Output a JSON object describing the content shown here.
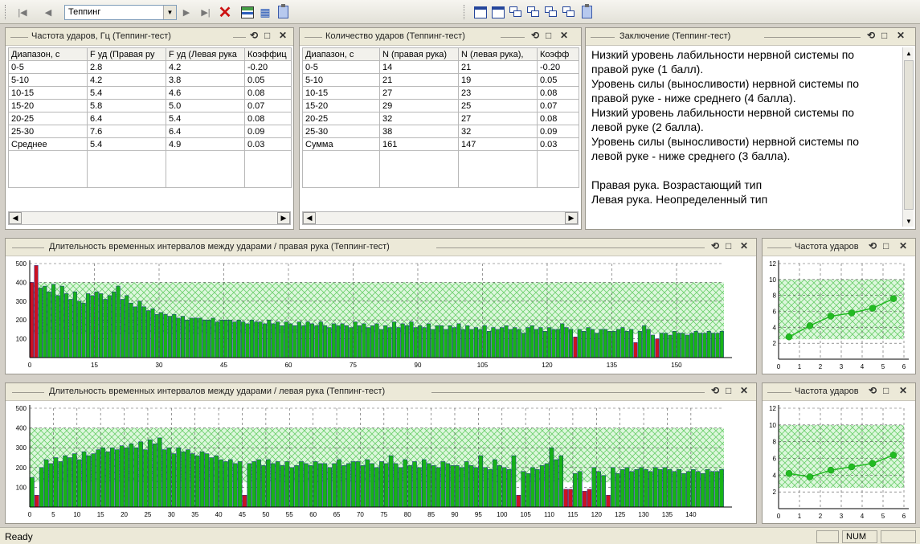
{
  "toolbar": {
    "combo_value": "Теппинг",
    "icons": [
      "first-icon",
      "prev-icon",
      "next-icon",
      "last-icon",
      "delete-icon",
      "chart-icon",
      "multichart-icon",
      "clipboard-icon",
      "window-icon",
      "window-icon",
      "tile-icon",
      "tile-icon",
      "tile-icon",
      "tile-icon",
      "clipboard-icon"
    ],
    "colors": {
      "delete": "#cc1111",
      "accent": "#24459b"
    }
  },
  "freq_table": {
    "title": "Частота ударов, Гц (Теппинг-тест)",
    "headers": [
      "Диапазон, с",
      "F уд (Правая ру",
      "F уд (Левая рука",
      "Коэффиц"
    ],
    "rows": [
      [
        "0-5",
        "2.8",
        "4.2",
        "-0.20"
      ],
      [
        "5-10",
        "4.2",
        "3.8",
        "0.05"
      ],
      [
        "10-15",
        "5.4",
        "4.6",
        "0.08"
      ],
      [
        "15-20",
        "5.8",
        "5.0",
        "0.07"
      ],
      [
        "20-25",
        "6.4",
        "5.4",
        "0.08"
      ],
      [
        "25-30",
        "7.6",
        "6.4",
        "0.09"
      ],
      [
        "Среднее",
        "5.4",
        "4.9",
        "0.03"
      ]
    ]
  },
  "count_table": {
    "title": "Количество ударов (Теппинг-тест)",
    "headers": [
      "Диапазон, с",
      "N (правая рука)",
      "N (левая рука),",
      "Коэфф"
    ],
    "rows": [
      [
        "0-5",
        "14",
        "21",
        "-0.20"
      ],
      [
        "5-10",
        "21",
        "19",
        "0.05"
      ],
      [
        "10-15",
        "27",
        "23",
        "0.08"
      ],
      [
        "15-20",
        "29",
        "25",
        "0.07"
      ],
      [
        "20-25",
        "32",
        "27",
        "0.08"
      ],
      [
        "25-30",
        "38",
        "32",
        "0.09"
      ],
      [
        "Сумма",
        "161",
        "147",
        "0.03"
      ]
    ]
  },
  "conclusion": {
    "title": "Заключение (Теппинг-тест)",
    "lines": [
      "Низкий уровень лабильности нервной системы по",
      "правой руке (1 балл).",
      "Уровень силы (выносливости) нервной системы по",
      "правой руке - ниже среднего (4 балла).",
      "Низкий уровень лабильности нервной системы по",
      "левой руке (2 балла).",
      "Уровень силы (выносливости) нервной системы по",
      "левой руке - ниже среднего (3 балла).",
      "",
      "Правая рука. Возрастающий тип",
      "Левая рука. Неопределенный тип"
    ]
  },
  "status": {
    "text": "Ready",
    "num": "NUM"
  },
  "chart_data": [
    {
      "type": "bar",
      "title": "Длительность временных интервалов между ударами / правая рука (Теппинг-тест)",
      "xlim": [
        0,
        161
      ],
      "ylim": [
        0,
        500
      ],
      "x_ticks": [
        "0",
        "15",
        "30",
        "45",
        "60",
        "75",
        "90",
        "105",
        "120",
        "135",
        "150"
      ],
      "y_ticks": [
        "100",
        "200",
        "300",
        "400",
        "500"
      ],
      "norm_band": [
        125,
        400
      ],
      "colors": {
        "bar": "#17b317",
        "bar_edge": "#1a2f8c",
        "highlight": "#cc1122",
        "band": "#99e699"
      },
      "highlight_index": [
        0,
        1,
        126,
        140,
        145
      ],
      "values": [
        400,
        490,
        370,
        380,
        350,
        390,
        330,
        380,
        340,
        310,
        350,
        300,
        290,
        340,
        330,
        350,
        340,
        310,
        330,
        350,
        380,
        310,
        330,
        290,
        270,
        300,
        270,
        250,
        260,
        230,
        240,
        230,
        220,
        230,
        210,
        220,
        200,
        210,
        210,
        210,
        200,
        200,
        210,
        190,
        200,
        200,
        200,
        190,
        200,
        190,
        180,
        200,
        190,
        190,
        180,
        200,
        180,
        190,
        170,
        190,
        180,
        170,
        190,
        170,
        190,
        180,
        170,
        190,
        170,
        160,
        180,
        170,
        180,
        170,
        160,
        190,
        170,
        180,
        160,
        170,
        180,
        150,
        170,
        160,
        190,
        160,
        180,
        170,
        190,
        160,
        170,
        160,
        180,
        150,
        170,
        170,
        150,
        170,
        160,
        180,
        150,
        170,
        150,
        160,
        150,
        170,
        140,
        160,
        150,
        160,
        170,
        150,
        160,
        150,
        130,
        160,
        170,
        150,
        160,
        140,
        160,
        150,
        150,
        180,
        160,
        150,
        110,
        150,
        140,
        160,
        150,
        130,
        150,
        150,
        140,
        140,
        150,
        160,
        140,
        150,
        80,
        140,
        170,
        150,
        120,
        100,
        130,
        130,
        120,
        140,
        130,
        130,
        120,
        130,
        140,
        130,
        130,
        140,
        130,
        130,
        140
      ]
    },
    {
      "type": "line",
      "title": "Частота ударов",
      "xlim": [
        0,
        6
      ],
      "ylim": [
        0,
        12
      ],
      "x_ticks": [
        "0",
        "1",
        "2",
        "3",
        "4",
        "5",
        "6"
      ],
      "y_ticks": [
        "2",
        "4",
        "6",
        "8",
        "10",
        "12"
      ],
      "norm_band": [
        2.5,
        10
      ],
      "colors": {
        "line": "#22bb22",
        "band": "#99e699"
      },
      "x": [
        0.5,
        1.5,
        2.5,
        3.5,
        4.5,
        5.5
      ],
      "values": [
        2.8,
        4.2,
        5.4,
        5.8,
        6.4,
        7.6
      ]
    },
    {
      "type": "bar",
      "title": "Длительность временных интервалов между ударами / левая рука (Теппинг-тест)",
      "xlim": [
        0,
        147
      ],
      "ylim": [
        0,
        500
      ],
      "x_ticks": [
        "0",
        "5",
        "10",
        "15",
        "20",
        "25",
        "30",
        "35",
        "40",
        "45",
        "50",
        "55",
        "60",
        "65",
        "70",
        "75",
        "80",
        "85",
        "90",
        "95",
        "100",
        "105",
        "110",
        "115",
        "120",
        "125",
        "130",
        "135",
        "140"
      ],
      "y_ticks": [
        "100",
        "200",
        "300",
        "400",
        "500"
      ],
      "norm_band": [
        125,
        400
      ],
      "colors": {
        "bar": "#17b317",
        "bar_edge": "#1a2f8c",
        "highlight": "#cc1122",
        "band": "#99e699"
      },
      "highlight_index": [
        1,
        45,
        103,
        113,
        114,
        117,
        118,
        122
      ],
      "values": [
        150,
        60,
        200,
        240,
        220,
        250,
        230,
        260,
        250,
        270,
        240,
        280,
        260,
        270,
        290,
        300,
        280,
        300,
        290,
        310,
        300,
        320,
        300,
        330,
        290,
        340,
        320,
        350,
        290,
        300,
        270,
        300,
        280,
        290,
        270,
        260,
        280,
        270,
        250,
        260,
        240,
        230,
        240,
        220,
        230,
        60,
        220,
        230,
        240,
        210,
        240,
        220,
        230,
        210,
        230,
        200,
        210,
        230,
        220,
        210,
        230,
        220,
        220,
        200,
        220,
        240,
        210,
        220,
        230,
        230,
        210,
        240,
        220,
        200,
        230,
        220,
        260,
        220,
        200,
        240,
        210,
        230,
        200,
        240,
        220,
        210,
        200,
        230,
        220,
        210,
        210,
        200,
        230,
        210,
        200,
        260,
        200,
        190,
        240,
        210,
        200,
        190,
        260,
        60,
        180,
        170,
        200,
        190,
        210,
        220,
        300,
        240,
        260,
        90,
        90,
        170,
        180,
        80,
        90,
        200,
        180,
        160,
        60,
        200,
        170,
        190,
        200,
        180,
        190,
        200,
        190,
        180,
        200,
        190,
        200,
        190,
        180,
        190,
        170,
        180,
        190,
        180,
        170,
        190,
        180,
        180,
        190
      ]
    },
    {
      "type": "line",
      "title": "Частота ударов",
      "xlim": [
        0,
        6
      ],
      "ylim": [
        0,
        12
      ],
      "x_ticks": [
        "0",
        "1",
        "2",
        "3",
        "4",
        "5",
        "6"
      ],
      "y_ticks": [
        "2",
        "4",
        "6",
        "8",
        "10",
        "12"
      ],
      "norm_band": [
        2.5,
        10
      ],
      "colors": {
        "line": "#22bb22",
        "band": "#99e699"
      },
      "x": [
        0.5,
        1.5,
        2.5,
        3.5,
        4.5,
        5.5
      ],
      "values": [
        4.2,
        3.8,
        4.6,
        5.0,
        5.4,
        6.4
      ]
    }
  ]
}
